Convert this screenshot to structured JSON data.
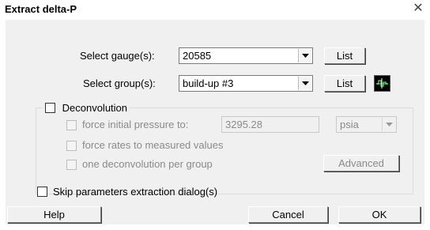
{
  "window": {
    "title": "Extract delta-P",
    "close_glyph": "✕"
  },
  "gauge": {
    "label": "Select gauge(s):",
    "value": "20585",
    "list_label": "List"
  },
  "group": {
    "label": "Select group(s):",
    "value": "build-up #3",
    "list_label": "List"
  },
  "deconvolution": {
    "label": "Deconvolution",
    "checked": false,
    "force_initial_pressure": {
      "label": "force initial pressure to:",
      "value": "3295.28",
      "unit": "psia"
    },
    "force_rates_label": "force rates to measured values",
    "one_per_group_label": "one deconvolution per group",
    "advanced_label": "Advanced"
  },
  "skip_params_label": "Skip parameters extraction dialog(s)",
  "buttons": {
    "help": "Help",
    "cancel": "Cancel",
    "ok": "OK"
  },
  "icons": {
    "close": "close-icon",
    "dropdown": "dropdown-arrow-icon",
    "plot": "plot-icon"
  },
  "colors": {
    "plot_icon_bg": "#000000",
    "plot_icon_fg": "#39d34a"
  }
}
